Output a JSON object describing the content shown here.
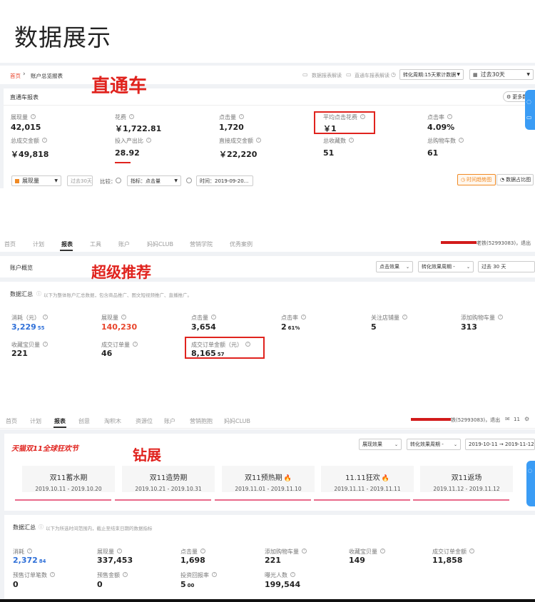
{
  "page_title": "数据展示",
  "section1": {
    "tag": "直通车",
    "breadcrumb_home": "首页",
    "breadcrumb_current": "账户总览报表",
    "link_report_read": "数据报表解读",
    "link_ztc_read": "直通车报表解读",
    "conversion_select": "转化周期:15天累计数据",
    "date_select": "过去30天",
    "report_title": "直通车报表",
    "more_data": "更多数据",
    "metrics": [
      {
        "label": "展现量",
        "value": "42,015"
      },
      {
        "label": "花费",
        "value": "￥1,722.81"
      },
      {
        "label": "点击量",
        "value": "1,720"
      },
      {
        "label": "平均点击花费",
        "value": "￥1"
      },
      {
        "label": "点击率",
        "value": "4.09%"
      },
      {
        "label": "总成交金额",
        "value": "￥49,818"
      },
      {
        "label": "投入产出比",
        "value": "28.92"
      },
      {
        "label": "直接成交金额",
        "value": "￥22,220"
      },
      {
        "label": "总收藏数",
        "value": "51"
      },
      {
        "label": "总购物车数",
        "value": "61"
      }
    ],
    "filter_metric": "展现量",
    "filter_period": "过去30天",
    "compare_label": "比较：",
    "indicator_select": "指标：点击量",
    "time_select": "时间：2019-09-20...",
    "btn_trend": "时间趋势图",
    "btn_ratio": "数据占比图"
  },
  "section2": {
    "tag": "超级推荐",
    "nav": [
      "首页",
      "计划",
      "报表",
      "工具",
      "账户",
      "妈妈CLUB",
      "营销学院",
      "优秀案例"
    ],
    "user": "老铁(52993083)，退出",
    "account_overview": "账户概览",
    "effect_select": "点击效果",
    "conversion_select": "转化效果周期 -",
    "date_select": "过去 30 天",
    "summary_title": "数据汇总",
    "summary_desc": "以下为整体账户汇总数据，包含商品推广、图文短视频推广、直播推广。",
    "metrics": [
      {
        "label": "消耗（元）",
        "value_main": "3,229",
        "value_small": "55",
        "color": "#2e6fd8"
      },
      {
        "label": "展现量",
        "value_main": "140,230",
        "value_small": "",
        "color": "#e8452c"
      },
      {
        "label": "点击量",
        "value_main": "3,654",
        "value_small": "",
        "color": "#222222"
      },
      {
        "label": "点击率",
        "value_main": "2",
        "value_small": "61%",
        "color": "#222222"
      },
      {
        "label": "关注店铺量",
        "value_main": "5",
        "value_small": "",
        "color": "#222222"
      },
      {
        "label": "添加购物车量",
        "value_main": "313",
        "value_small": "",
        "color": "#222222"
      },
      {
        "label": "收藏宝贝量",
        "value_main": "221",
        "value_small": "",
        "color": "#222222"
      },
      {
        "label": "成交订单量",
        "value_main": "46",
        "value_small": "",
        "color": "#222222"
      },
      {
        "label": "成交订单金额（元）",
        "value_main": "8,165",
        "value_small": "57",
        "color": "#222222"
      }
    ]
  },
  "section3": {
    "tag": "钻展",
    "nav": [
      "首页",
      "计划",
      "报表",
      "创意",
      "淘积木",
      "资源位",
      "账户",
      "营销抱抱",
      "妈妈CLUB"
    ],
    "user": "铁(52993083)，退出",
    "msg_count": "11",
    "banner": "天猫双11全球狂欢节",
    "effect_select": "展现效果",
    "conversion_select": "转化效果周期 -",
    "date_range": "2019-10-11  →  2019-11-12",
    "stages": [
      {
        "name": "双11蓄水期",
        "date": "2019.10.11 - 2019.10.20",
        "hot": false
      },
      {
        "name": "双11造势期",
        "date": "2019.10.21 - 2019.10.31",
        "hot": false
      },
      {
        "name": "双11预热期",
        "date": "2019.11.01 - 2019.11.10",
        "hot": true
      },
      {
        "name": "11.11狂欢",
        "date": "2019.11.11 - 2019.11.11",
        "hot": true
      },
      {
        "name": "双11返场",
        "date": "2019.11.12 - 2019.11.12",
        "hot": false
      }
    ],
    "summary_title": "数据汇总",
    "summary_desc": "以下为所选时间范围内，截止至结束日期的数据指标",
    "metrics": [
      {
        "label": "消耗",
        "value_main": "2,372",
        "value_small": "84",
        "color": "#2e6fd8"
      },
      {
        "label": "展现量",
        "value_main": "337,453",
        "value_small": "",
        "color": "#222222"
      },
      {
        "label": "点击量",
        "value_main": "1,698",
        "value_small": "",
        "color": "#222222"
      },
      {
        "label": "添加购物车量",
        "value_main": "221",
        "value_small": "",
        "color": "#222222"
      },
      {
        "label": "收藏宝贝量",
        "value_main": "149",
        "value_small": "",
        "color": "#222222"
      },
      {
        "label": "成交订单金额",
        "value_main": "11,858",
        "value_small": "",
        "color": "#222222"
      },
      {
        "label": "预售订单笔数",
        "value_main": "0",
        "value_small": "",
        "color": "#222222"
      },
      {
        "label": "预售金额",
        "value_main": "0",
        "value_small": "",
        "color": "#222222"
      },
      {
        "label": "投资回报率",
        "value_main": "5",
        "value_small": "00",
        "color": "#222222"
      },
      {
        "label": "曝光人数",
        "value_main": "199,544",
        "value_small": "",
        "color": "#222222"
      }
    ]
  }
}
